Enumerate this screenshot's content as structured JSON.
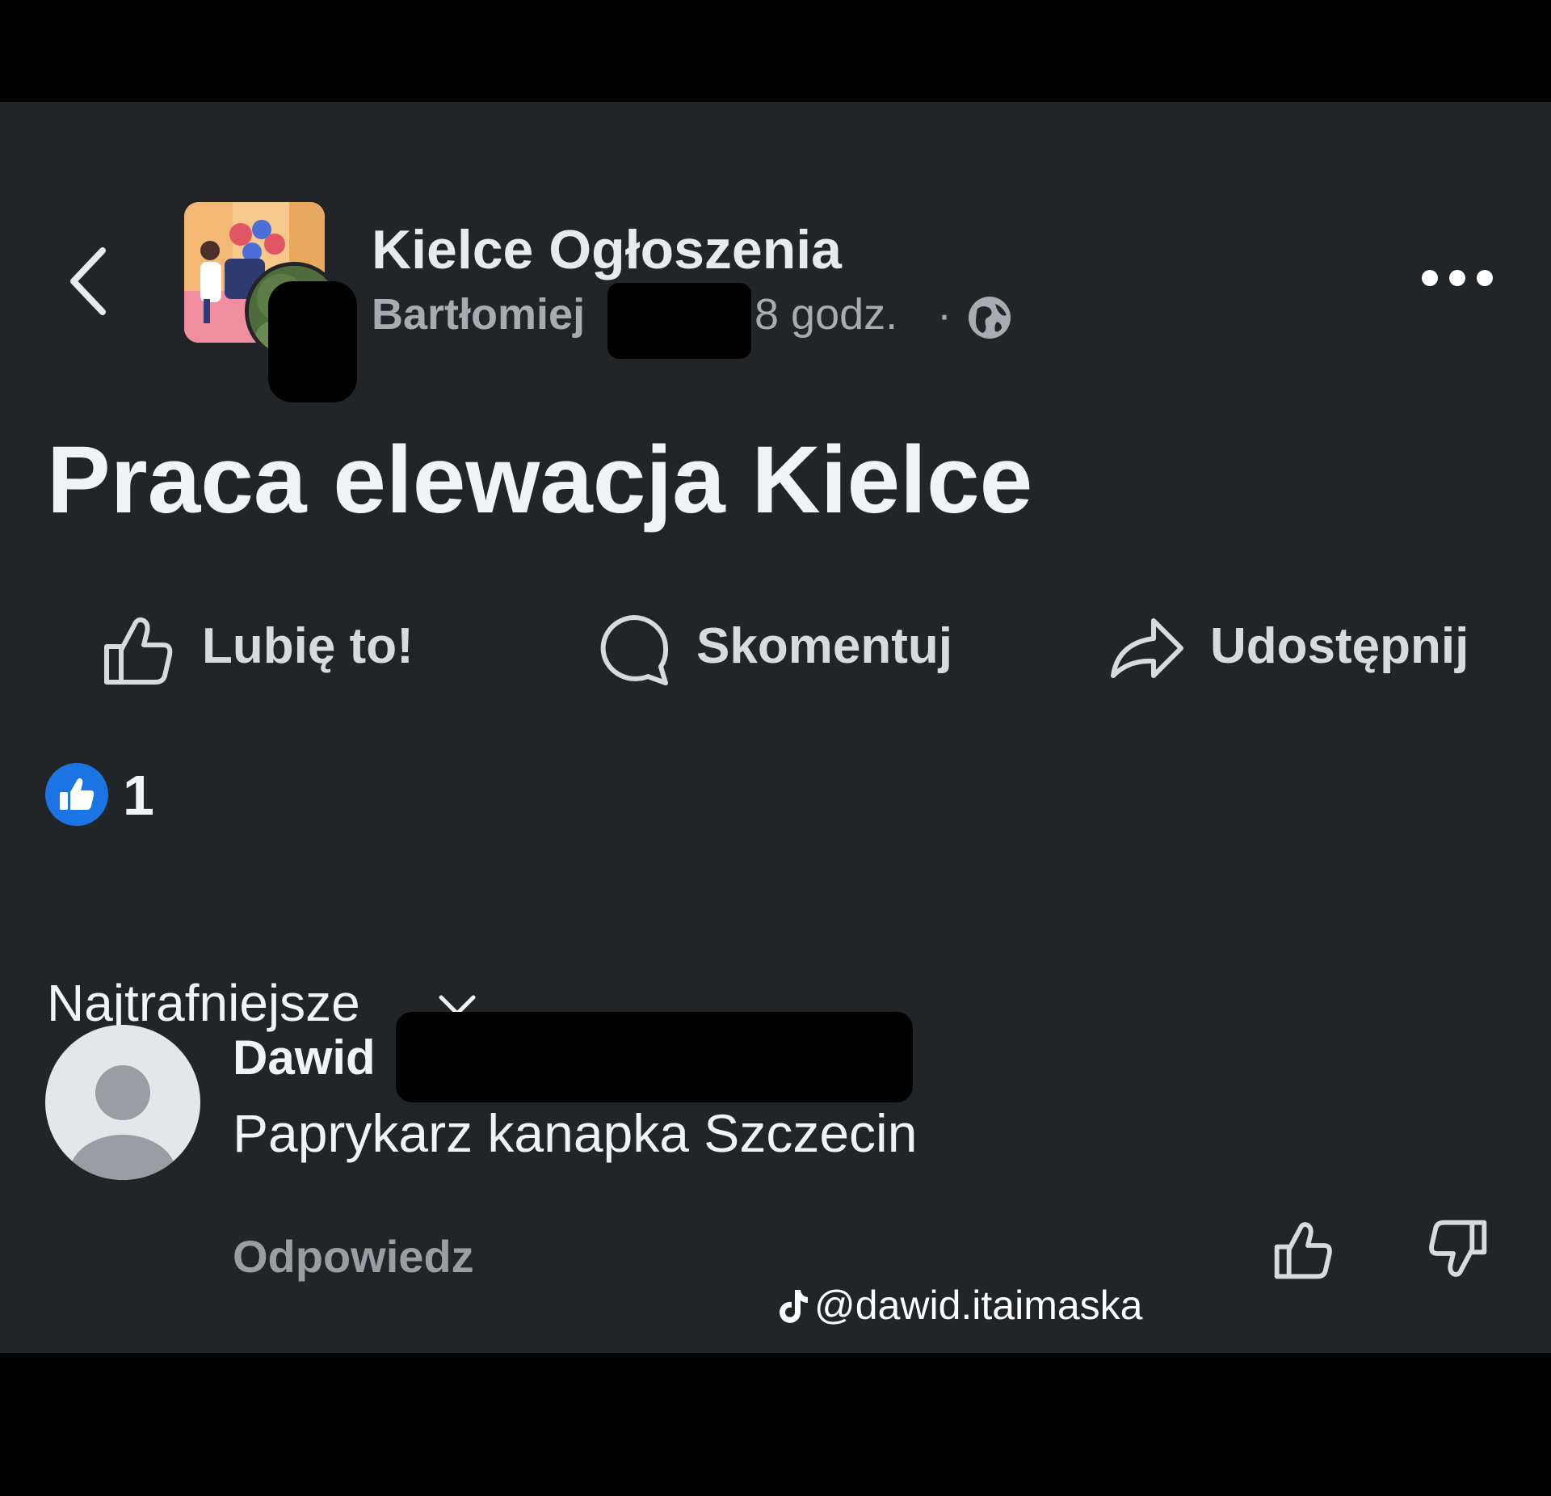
{
  "header": {
    "back_icon": "chevron-left-icon",
    "group_name": "Kielce Ogłoszenia",
    "author_name": "Bartłomiej",
    "time_ago": "8 godz.",
    "separator": "·",
    "audience_icon": "globe-icon",
    "more_icon": "more-horizontal-icon"
  },
  "post": {
    "title": "Praca elewacja Kielce"
  },
  "actions": {
    "like_label": "Lubię to!",
    "comment_label": "Skomentuj",
    "share_label": "Udostępnij"
  },
  "reactions": {
    "icon": "like-reaction-icon",
    "count": "1"
  },
  "comments": {
    "sort_label": "Najtrafniejsze",
    "items": [
      {
        "author": "Dawid",
        "text": "Paprykarz kanapka Szczecin",
        "reply_label": "Odpowiedz"
      }
    ]
  },
  "watermark": {
    "icon": "tiktok-icon",
    "handle": "@dawid.itaimaska"
  },
  "colors": {
    "background": "#222527",
    "letterbox": "#000000",
    "text_primary": "#f2f3f5",
    "text_secondary": "#a8acb0",
    "like_blue": "#1b74e4"
  }
}
